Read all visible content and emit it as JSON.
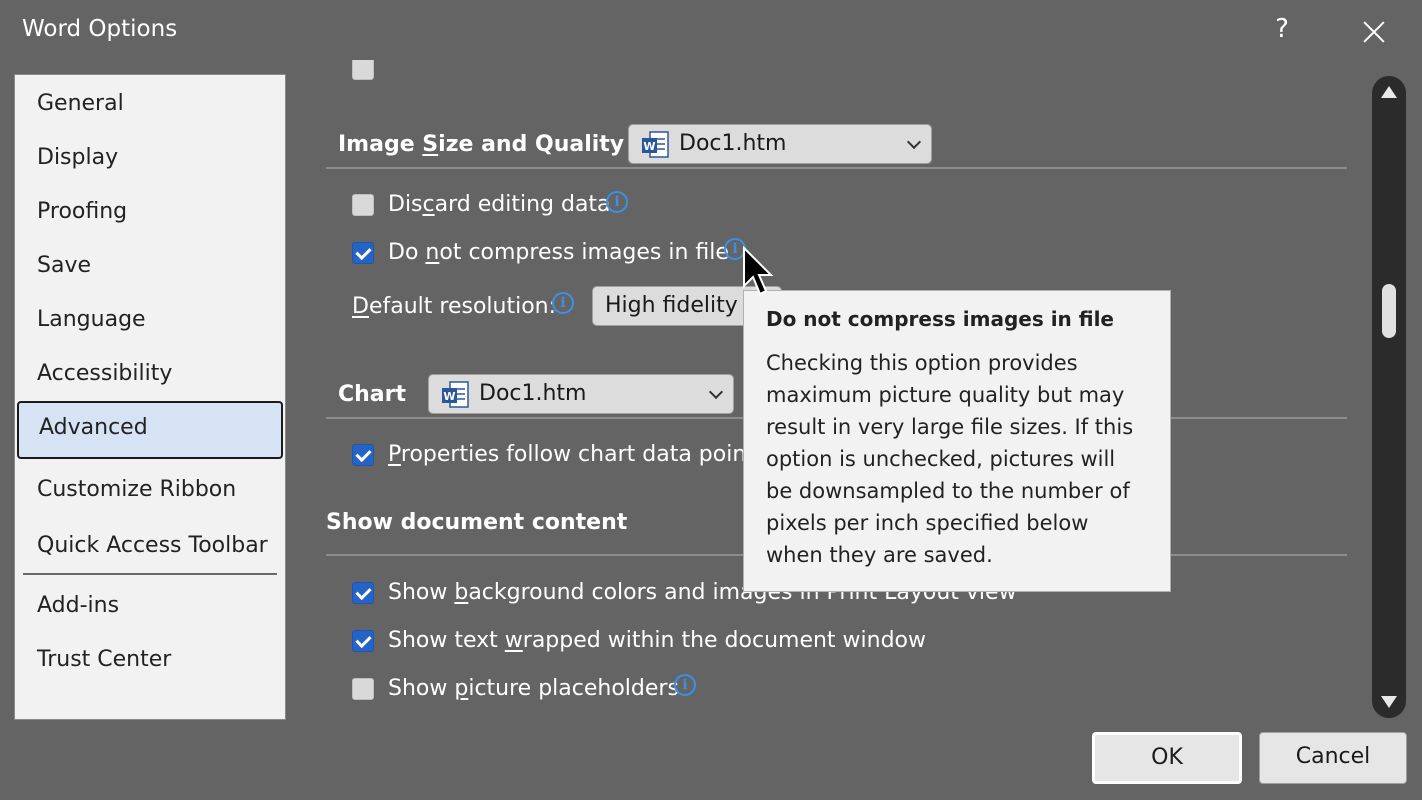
{
  "window": {
    "title": "Word Options",
    "help_label": "?"
  },
  "sidebar": {
    "items": [
      {
        "label": "General"
      },
      {
        "label": "Display"
      },
      {
        "label": "Proofing"
      },
      {
        "label": "Save"
      },
      {
        "label": "Language"
      },
      {
        "label": "Accessibility"
      },
      {
        "label": "Advanced",
        "active": true
      },
      {
        "label": "Customize Ribbon"
      },
      {
        "label": "Quick Access Toolbar"
      },
      {
        "label": "Add-ins"
      },
      {
        "label": "Trust Center"
      }
    ]
  },
  "image_section": {
    "title_pre": "Image ",
    "title_accel": "S",
    "title_post": "ize and Quality",
    "doc_select": "Doc1.htm",
    "discard": {
      "pre": "Dis",
      "accel": "c",
      "post": "ard editing data",
      "checked": false
    },
    "no_compress": {
      "pre": "Do ",
      "accel": "n",
      "post": "ot compress images in file",
      "checked": true
    },
    "resolution": {
      "pre": "",
      "accel": "D",
      "post": "efault resolution:",
      "value": "High fidelity"
    }
  },
  "chart_section": {
    "title": "Chart",
    "doc_select": "Doc1.htm",
    "props": {
      "pre": "",
      "accel": "P",
      "post": "roperties follow chart data point",
      "checked": true
    }
  },
  "content_section": {
    "title": "Show document content",
    "bg_colors": {
      "pre": "Show ",
      "accel": "b",
      "post": "ackground colors and images in Print Layout view",
      "checked": true
    },
    "text_wrapped": {
      "pre": "Show text ",
      "accel": "w",
      "post": "rapped within the document window",
      "checked": true
    },
    "placeholders": {
      "pre": "Show ",
      "accel": "p",
      "post": "icture placeholders",
      "checked": false
    }
  },
  "tooltip": {
    "title": "Do not compress images in file",
    "body": "Checking this option provides maximum picture quality but may result in very large file sizes. If this option is unchecked, pictures will be downsampled to the number of pixels per inch specified below when they are saved."
  },
  "buttons": {
    "ok": "OK",
    "cancel": "Cancel"
  },
  "colors": {
    "background": "#646464",
    "accent": "#2563c4",
    "info": "#3f8ee8",
    "active_nav": "#d5e3f5"
  }
}
